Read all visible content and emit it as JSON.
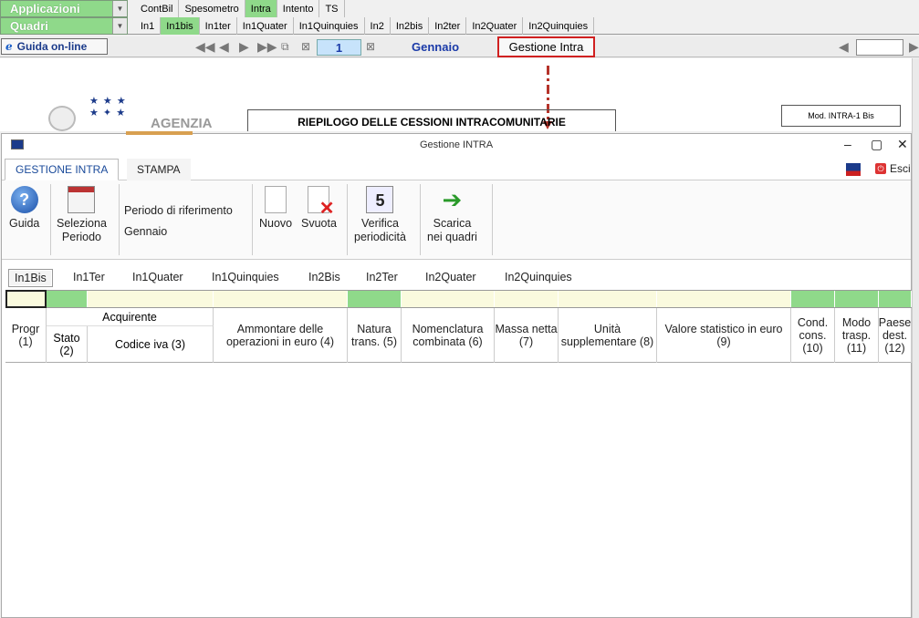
{
  "app_bar": {
    "applicazioni": "Applicazioni",
    "quadri": "Quadri",
    "top_tabs": [
      "ContBil",
      "Spesometro",
      "Intra",
      "Intento",
      "TS"
    ],
    "top_tab_selected": "Intra",
    "quadri_tabs": [
      "In1",
      "In1bis",
      "In1ter",
      "In1Quater",
      "In1Quinquies",
      "In2",
      "In2bis",
      "In2ter",
      "In2Quater",
      "In2Quinquies"
    ],
    "quadri_tab_selected": "In1bis"
  },
  "toolbar": {
    "guida_online": "Guida on-line",
    "page_number": "1",
    "month": "Gennaio",
    "gestione_intra": "Gestione Intra"
  },
  "document": {
    "agenzia": "AGENZIA",
    "riepilogo_title": "RIEPILOGO DELLE CESSIONI INTRACOMUNITARIE",
    "modulo": "Mod. INTRA-1 Bis"
  },
  "window": {
    "title": "Gestione INTRA",
    "ribbon_tabs": [
      "GESTIONE INTRA",
      "STAMPA"
    ],
    "esci": "Esci",
    "buttons": {
      "guida": "Guida",
      "seleziona_l1": "Seleziona",
      "seleziona_l2": "Periodo",
      "periodo_label": "Periodo di riferimento",
      "periodo_value": "Gennaio",
      "nuovo": "Nuovo",
      "svuota": "Svuota",
      "verifica_l1": "Verifica",
      "verifica_l2": "periodicità",
      "scarica_l1": "Scarica",
      "scarica_l2": "nei quadri"
    },
    "inner_tabs": [
      "In1Bis",
      "In1Ter",
      "In1Quater",
      "In1Quinquies",
      "In2Bis",
      "In2Ter",
      "In2Quater",
      "In2Quinquies"
    ],
    "inner_tab_selected": "In1Bis",
    "columns": {
      "progr": "Progr (1)",
      "acquirente": "Acquirente",
      "stato": "Stato (2)",
      "codice_iva": "Codice iva (3)",
      "ammontare": "Ammontare delle operazioni in euro (4)",
      "natura": "Natura trans. (5)",
      "nomenclatura": "Nomenclatura combinata (6)",
      "massa": "Massa netta (7)",
      "unita": "Unità supplementare (8)",
      "valore": "Valore statistico in euro (9)",
      "cond": "Cond. cons. (10)",
      "modo": "Modo trasp. (11)",
      "paese": "Paese dest. (12)"
    }
  },
  "colors": {
    "green": "#8fd98a",
    "yellow": "#fafade",
    "accent_red": "#d02020",
    "link_blue": "#1a3aa8"
  }
}
